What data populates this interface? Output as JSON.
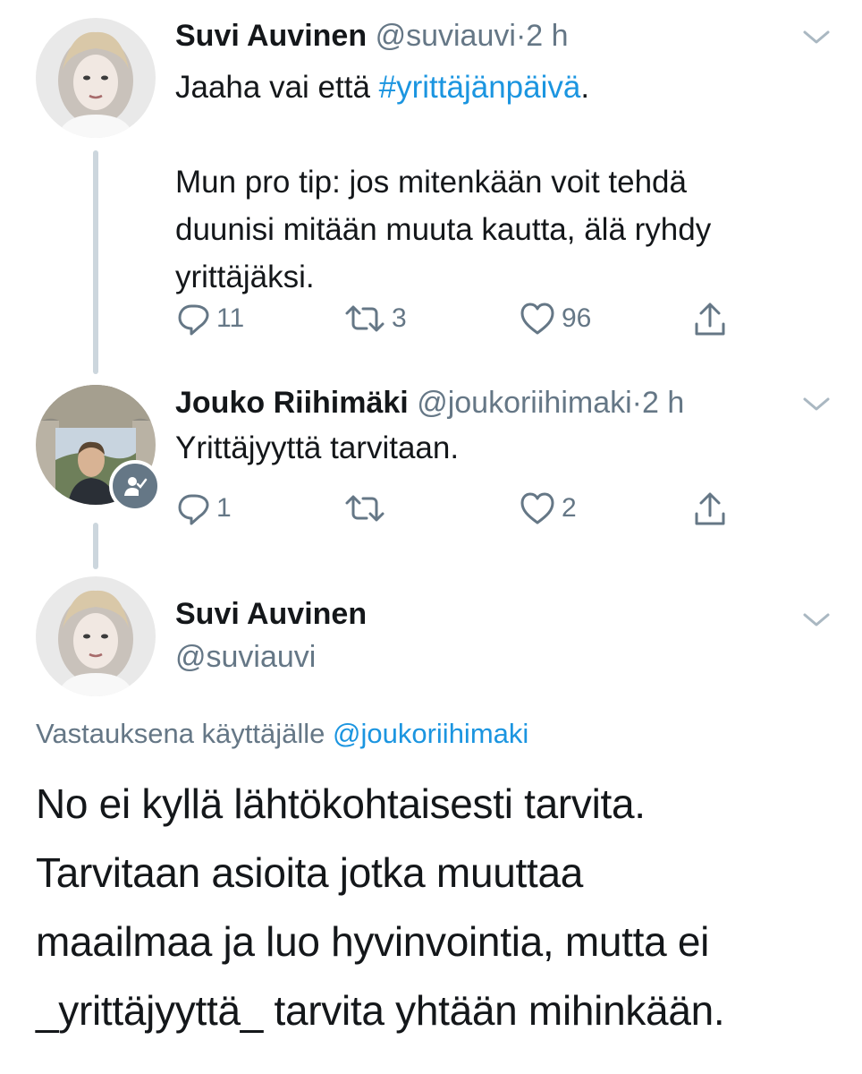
{
  "tweet1": {
    "name": "Suvi Auvinen",
    "handle": "@suviauvi",
    "separator": "·",
    "time": "2 h",
    "text_prefix": "Jaaha vai että ",
    "hashtag": "#yrittäjänpäivä",
    "text_suffix": ".",
    "text_line2": "Mun pro tip: jos mitenkään voit tehdä",
    "text_line3": "duunisi mitään muuta kautta, älä ryhdy",
    "text_line4": "yrittäjäksi.",
    "replies": "11",
    "retweets": "3",
    "likes": "96"
  },
  "tweet2": {
    "name": "Jouko Riihimäki",
    "handle": "@joukoriihimaki",
    "separator": "·",
    "time": "2 h",
    "text": "Yrittäjyyttä tarvitaan.",
    "replies": "1",
    "retweets": "",
    "likes": "2"
  },
  "tweet3": {
    "name": "Suvi Auvinen",
    "handle": "@suviauvi",
    "reply_label": "Vastauksena käyttäjälle ",
    "reply_mention": "@joukoriihimaki",
    "line1": "No ei kyllä lähtökohtaisesti tarvita.",
    "line2": "Tarvitaan asioita jotka muuttaa",
    "line3": "maailmaa ja luo hyvinvointia, mutta ei",
    "line4": "_yrittäjyyttä_ tarvita yhtään mihinkään."
  },
  "colors": {
    "link": "#1b95e0",
    "secondary_text": "#657786",
    "thread_line": "#ccd6dd"
  },
  "icons": [
    "reply-icon",
    "retweet-icon",
    "like-icon",
    "share-icon",
    "chevron-down-icon",
    "verified-user-badge-icon"
  ]
}
